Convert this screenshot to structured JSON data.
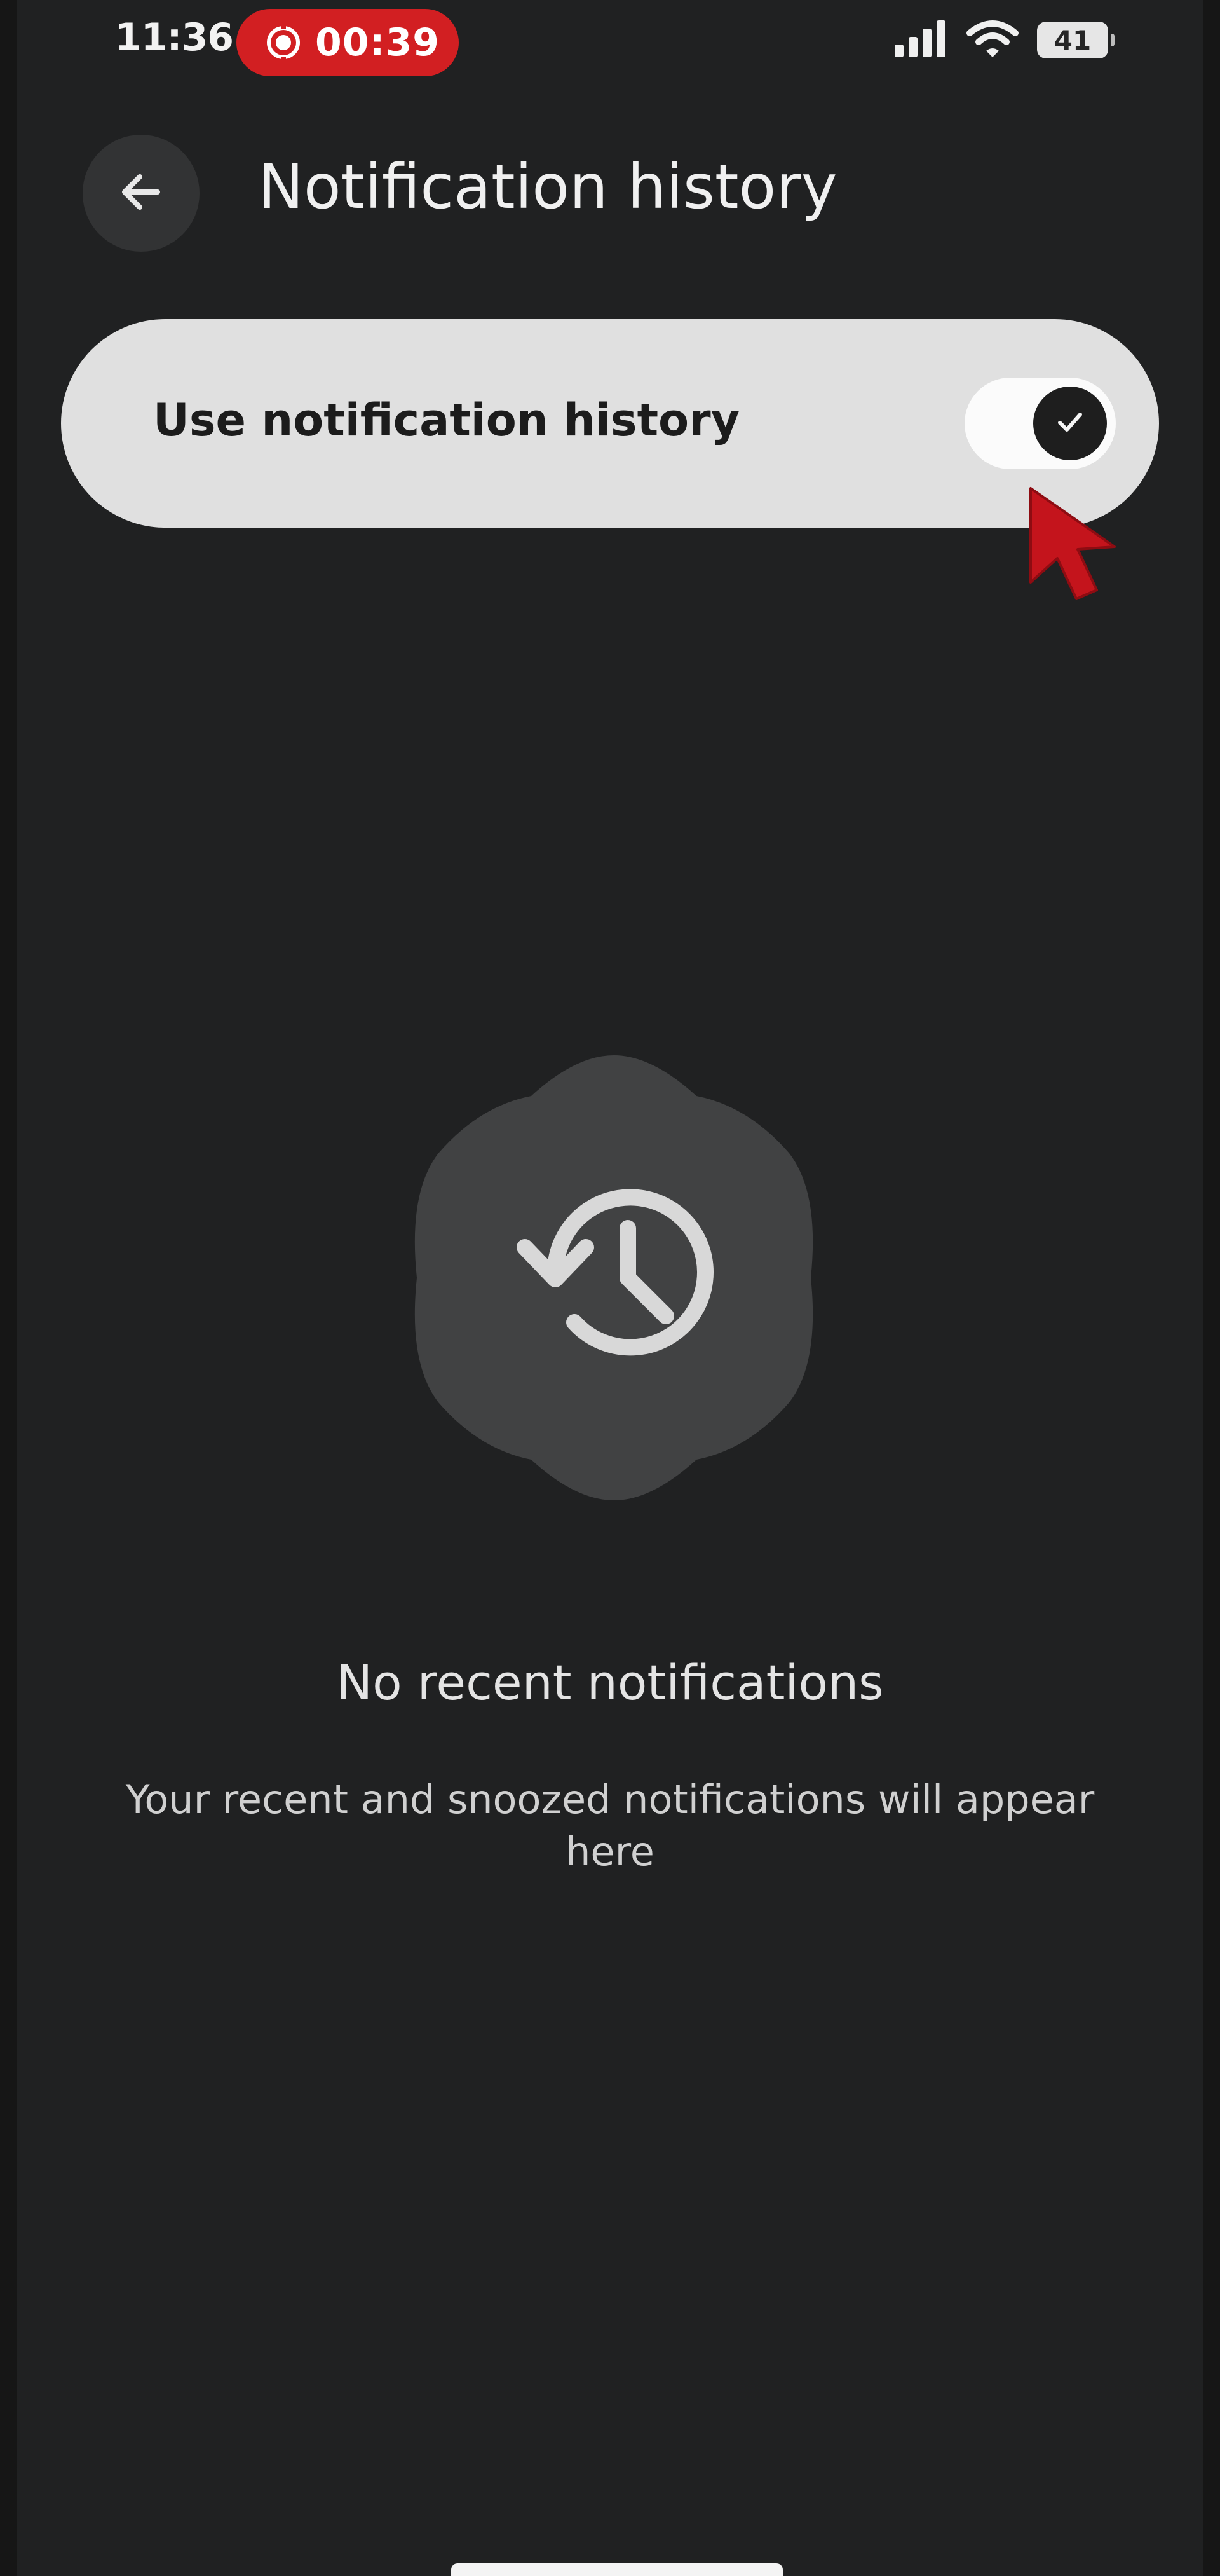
{
  "status_bar": {
    "time": "11:36",
    "recording_time": "00:39",
    "battery_level": "41",
    "icons": [
      "record-icon",
      "signal-icon",
      "wifi-icon",
      "battery-icon"
    ]
  },
  "header": {
    "title": "Notification history",
    "back_icon": "arrow-left-icon"
  },
  "setting": {
    "label": "Use notification history",
    "enabled": true,
    "thumb_icon": "check-icon"
  },
  "empty_state": {
    "icon": "history-icon",
    "title": "No recent notifications",
    "description": "Your recent and snoozed notifications will appear here"
  },
  "colors": {
    "background": "#202122",
    "recording": "#d21f22",
    "card": "#e0e0e0",
    "cursor": "#c4141c"
  }
}
